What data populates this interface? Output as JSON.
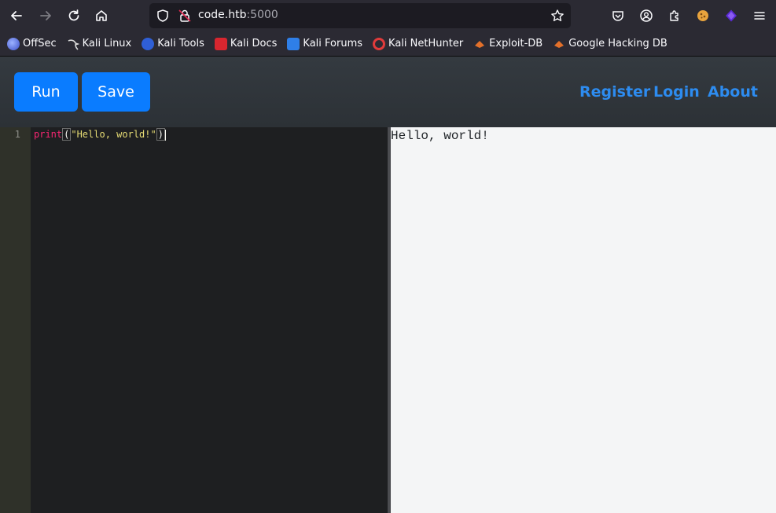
{
  "browser": {
    "url_host": "code.htb",
    "url_port": ":5000"
  },
  "bookmarks": [
    {
      "label": "OffSec",
      "icon": "offsec-icon",
      "color": "#5b7ce6"
    },
    {
      "label": "Kali Linux",
      "icon": "kali-dragon-icon",
      "color": "#cfcfcf"
    },
    {
      "label": "Kali Tools",
      "icon": "kali-tools-icon",
      "color": "#3d6fe8"
    },
    {
      "label": "Kali Docs",
      "icon": "kali-docs-icon",
      "color": "#d8262f"
    },
    {
      "label": "Kali Forums",
      "icon": "kali-forums-icon",
      "color": "#2f7fe8"
    },
    {
      "label": "Kali NetHunter",
      "icon": "nethunter-icon",
      "color": "#e03b3b"
    },
    {
      "label": "Exploit-DB",
      "icon": "exploit-db-icon",
      "color": "#e3702a"
    },
    {
      "label": "Google Hacking DB",
      "icon": "ghdb-icon",
      "color": "#e3702a"
    }
  ],
  "header": {
    "run_label": "Run",
    "save_label": "Save",
    "nav": [
      "Register",
      "Login",
      "About"
    ]
  },
  "editor": {
    "line_number": "1",
    "code_fn": "print",
    "code_open": "(",
    "code_str": "\"Hello, world!\"",
    "code_close": ")"
  },
  "output": {
    "text": "Hello, world!"
  },
  "colors": {
    "accent": "#0a7cff",
    "link": "#2d8cf0"
  }
}
